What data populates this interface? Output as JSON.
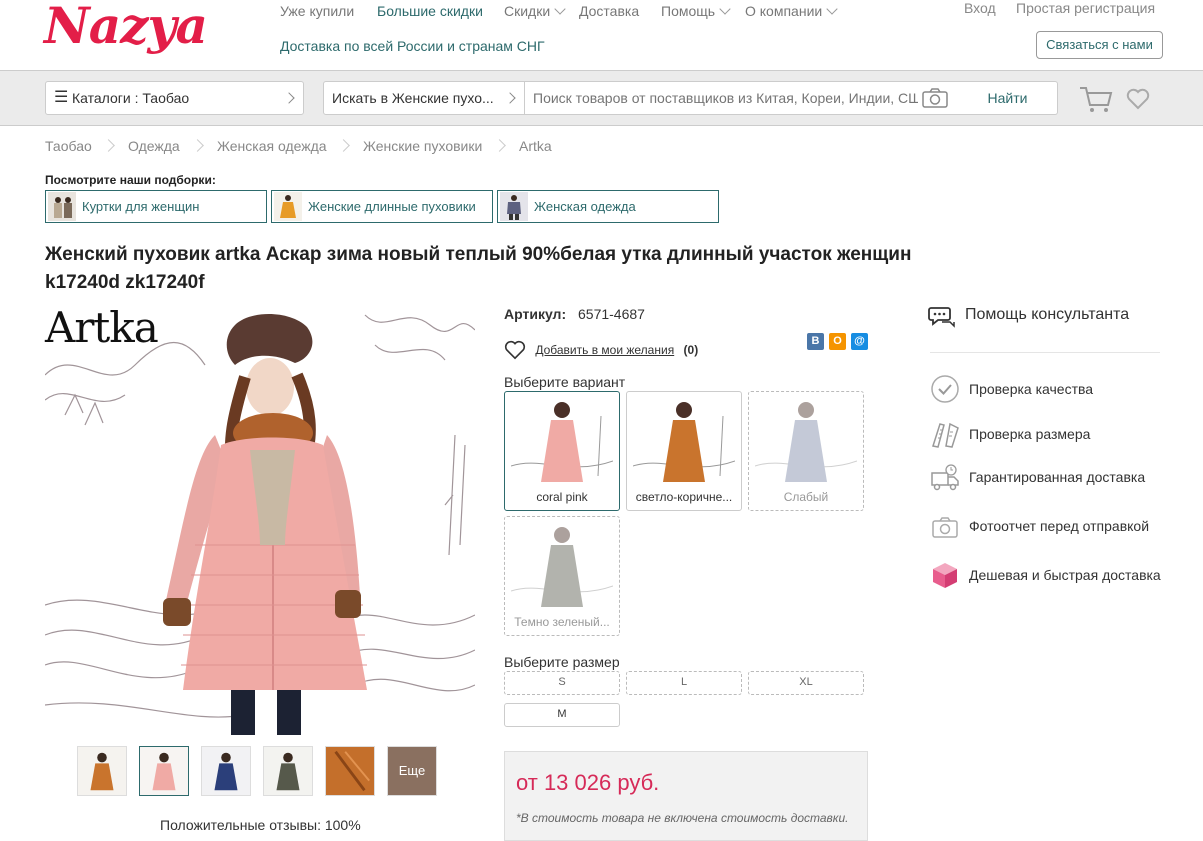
{
  "header": {
    "logo": "Nazya",
    "nav": [
      "Уже купили",
      "Большие скидки",
      "Скидки",
      "Доставка",
      "Помощь",
      "О компании"
    ],
    "shipping_text": "Доставка по всей России и странам СНГ",
    "login": "Вход",
    "register": "Простая регистрация",
    "contact": "Связаться с нами"
  },
  "search": {
    "catalog": "Каталоги : Таобао",
    "scope": "Искать в Женские пухо...",
    "placeholder": "Поиск товаров от поставщиков из Китая, Кореи, Индии, США",
    "button": "Найти"
  },
  "breadcrumbs": [
    "Таобао",
    "Одежда",
    "Женская одежда",
    "Женские пуховики",
    "Artka"
  ],
  "collections": {
    "title": "Посмотрите наши подборки:",
    "items": [
      "Куртки для женщин",
      "Женские длинные пуховики",
      "Женская одежда"
    ]
  },
  "product": {
    "title": "Женский пуховик artka Аскар зима новый теплый 90%белая утка длинный участок женщин k17240d zk17240f",
    "brand_logo": "Artka",
    "sku_label": "Артикул:",
    "sku": "6571-4687",
    "wishlist_label": "Добавить в мои желания",
    "wishlist_count": "(0)",
    "social": [
      "В",
      "О",
      "@"
    ],
    "variant_label": "Выберите вариант",
    "variants": [
      {
        "name": "coral pink",
        "color": "#f0a7a2",
        "available": true,
        "selected": true
      },
      {
        "name": "светло-коричне...",
        "color": "#c9742d",
        "available": true,
        "selected": false
      },
      {
        "name": "Слабый",
        "color": "#7d8aa8",
        "available": false,
        "selected": false
      },
      {
        "name": "Темно зеленый...",
        "color": "#56594b",
        "available": false,
        "selected": false
      }
    ],
    "size_label": "Выберите размер",
    "sizes": [
      {
        "name": "S",
        "available": false
      },
      {
        "name": "L",
        "available": false
      },
      {
        "name": "XL",
        "available": false
      },
      {
        "name": "M",
        "available": true
      }
    ],
    "thumb_more": "Еще",
    "reviews": "Положительные отзывы: 100%",
    "price": "от 13 026 руб.",
    "price_note": "*В стоимость товара не включена стоимость доставки."
  },
  "help": {
    "consultant": "Помощь консультанта",
    "features": [
      {
        "label": "Проверка качества",
        "icon": "check-circle-icon"
      },
      {
        "label": "Проверка размера",
        "icon": "ruler-icon"
      },
      {
        "label": "Гарантированная доставка",
        "icon": "truck-icon"
      },
      {
        "label": "Фотоотчет перед отправкой",
        "icon": "camera-icon"
      },
      {
        "label": "Дешевая и быстрая доставка",
        "icon": "box-icon"
      }
    ]
  }
}
